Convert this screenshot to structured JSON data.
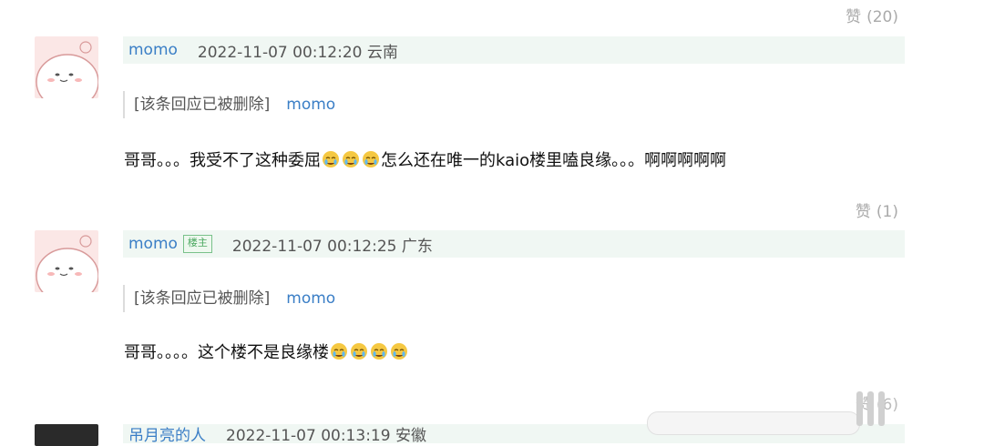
{
  "likes": [
    {
      "label": "赞",
      "count": "(20)"
    },
    {
      "label": "赞",
      "count": "(1)"
    },
    {
      "label": "赞",
      "count": "(6)"
    }
  ],
  "comments": [
    {
      "user": "momo",
      "badge": "",
      "meta": "2022-11-07 00:12:20 云南",
      "quote": {
        "text": "[该条回应已被删除]",
        "user": "momo"
      },
      "text_before": "哥哥。。。我受不了这种委屈",
      "text_after": "怎么还在唯一的kaio楼里嗑良缘。。。啊啊啊啊啊",
      "emoji_count": 3
    },
    {
      "user": "momo",
      "badge": "楼主",
      "meta": "2022-11-07 00:12:25 广东",
      "quote": {
        "text": "[该条回应已被删除]",
        "user": "momo"
      },
      "text_before": "哥哥。。。。这个楼不是良缘楼",
      "text_after": "",
      "emoji_count": 4
    },
    {
      "user": "吊月亮的人",
      "badge": "",
      "meta": "2022-11-07 00:13:19 安徽"
    }
  ],
  "icons": {
    "avatar": "cartoon-avatar-icon",
    "emoji": "crying-face-emoji-icon"
  }
}
